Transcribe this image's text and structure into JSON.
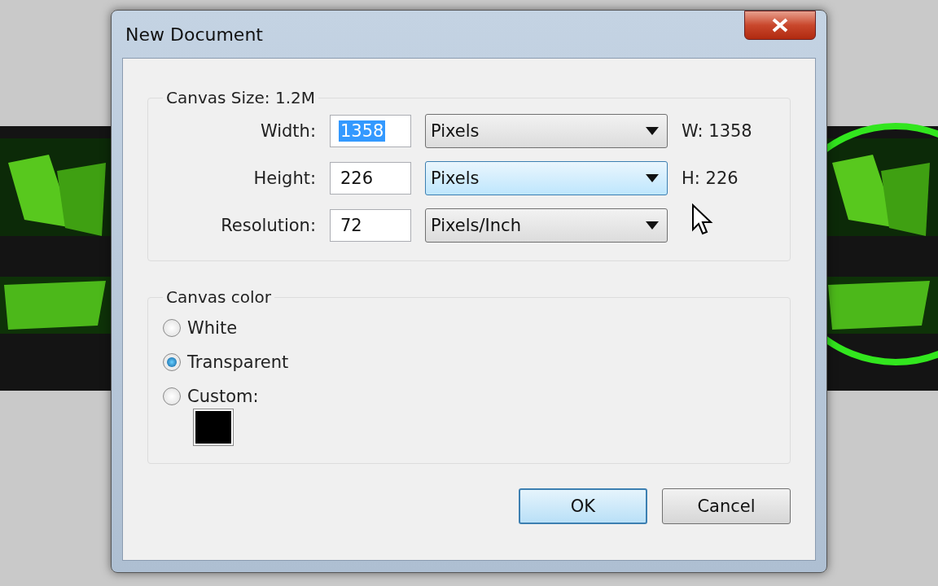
{
  "window": {
    "title": "New Document"
  },
  "canvas_size": {
    "title": "Canvas Size: 1.2M",
    "rows": [
      {
        "label": "Width:",
        "value": "1358",
        "text_selected": true,
        "unit": "Pixels",
        "unit_focused": false,
        "readout": "W: 1358"
      },
      {
        "label": "Height:",
        "value": "226",
        "text_selected": false,
        "unit": "Pixels",
        "unit_focused": true,
        "readout": "H: 226"
      },
      {
        "label": "Resolution:",
        "value": "72",
        "text_selected": false,
        "unit": "Pixels/Inch",
        "unit_focused": false
      }
    ]
  },
  "canvas_color": {
    "title": "Canvas color",
    "options": [
      {
        "label": "White",
        "selected": false
      },
      {
        "label": "Transparent",
        "selected": true
      },
      {
        "label": "Custom:",
        "selected": false
      }
    ]
  },
  "buttons": [
    {
      "label": "OK",
      "default": true
    },
    {
      "label": "Cancel",
      "default": false
    }
  ]
}
